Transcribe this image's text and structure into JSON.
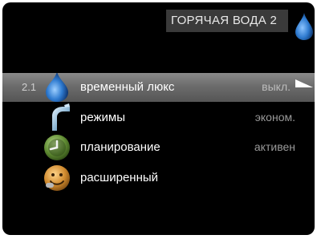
{
  "header": {
    "title": "ГОРЯЧАЯ ВОДА 2",
    "icon": "water-drop-icon"
  },
  "menu": {
    "selected_number": "2.1",
    "items": [
      {
        "label": "временный люкс",
        "value": "выкл.",
        "icon": "water-drop-icon",
        "selected": true
      },
      {
        "label": "режимы",
        "value": "эконом.",
        "icon": "faucet-icon",
        "selected": false
      },
      {
        "label": "планирование",
        "value": "активен",
        "icon": "clock-icon",
        "selected": false
      },
      {
        "label": "расширенный",
        "value": "",
        "icon": "face-icon",
        "selected": false
      }
    ]
  },
  "colors": {
    "background": "#000000",
    "selected_row": "#6c6c6c",
    "drop_blue": "#2f7bd0"
  }
}
